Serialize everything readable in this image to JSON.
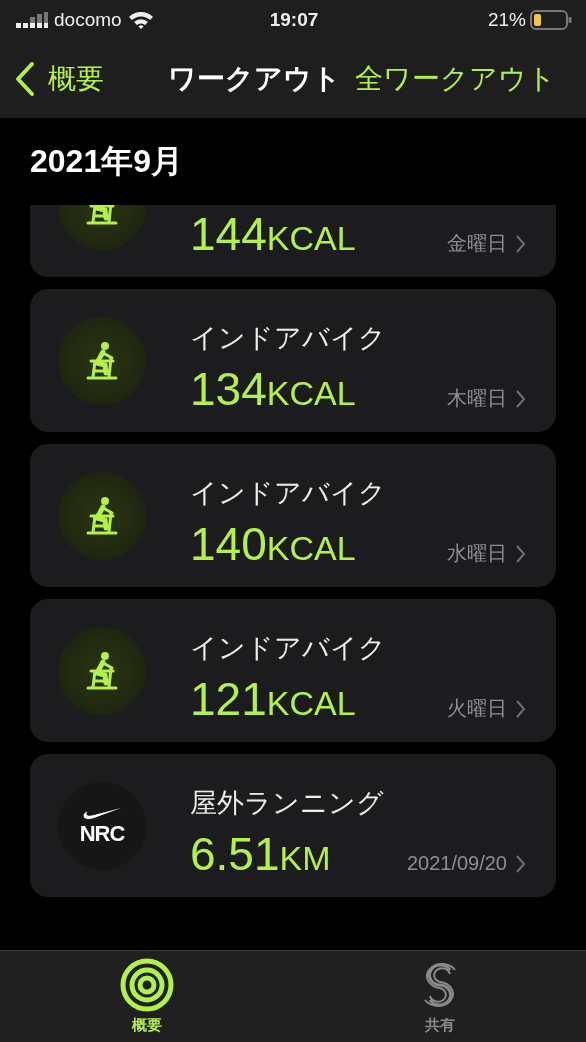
{
  "status_bar": {
    "carrier": "docomo",
    "time": "19:07",
    "battery": "21%"
  },
  "nav": {
    "back": "概要",
    "title": "ワークアウト",
    "action": "全ワークアウト"
  },
  "section": "2021年9月",
  "workouts": [
    {
      "kind": "bike",
      "value": "144",
      "unit": "KCAL",
      "day": "金曜日"
    },
    {
      "kind": "bike",
      "name": "インドアバイク",
      "value": "134",
      "unit": "KCAL",
      "day": "木曜日"
    },
    {
      "kind": "bike",
      "name": "インドアバイク",
      "value": "140",
      "unit": "KCAL",
      "day": "水曜日"
    },
    {
      "kind": "bike",
      "name": "インドアバイク",
      "value": "121",
      "unit": "KCAL",
      "day": "火曜日"
    },
    {
      "kind": "nrc",
      "badge": "NRC",
      "name": "屋外ランニング",
      "value": "6.51",
      "unit": "KM",
      "day": "2021/09/20"
    }
  ],
  "tabs": [
    {
      "kind": "rings",
      "label": "概要",
      "selected": true
    },
    {
      "kind": "sharing",
      "label": "共有",
      "selected": false
    }
  ]
}
